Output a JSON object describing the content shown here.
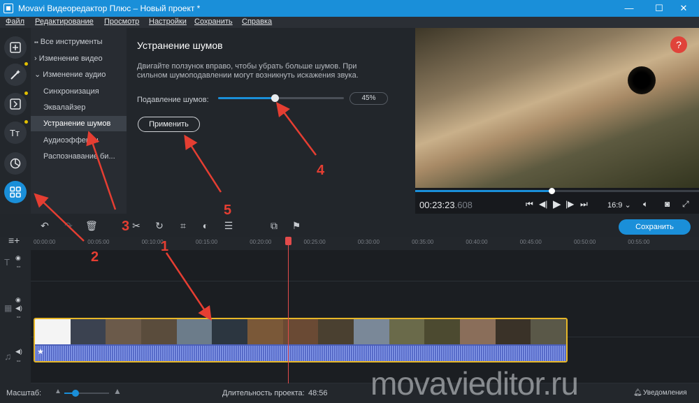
{
  "window": {
    "title": "Movavi Видеоредактор Плюс – Новый проект *",
    "minimize": "—",
    "maximize": "☐",
    "close": "✕"
  },
  "menu": [
    "Файл",
    "Редактирование",
    "Просмотр",
    "Настройки",
    "Сохранить",
    "Справка"
  ],
  "tools": {
    "items": [
      {
        "label": "Все инструменты",
        "prefix": "▪▪"
      },
      {
        "label": "Изменение видео",
        "prefix": "›"
      },
      {
        "label": "Изменение аудио",
        "prefix": "⌄"
      },
      {
        "label": "Синхронизация",
        "prefix": ""
      },
      {
        "label": "Эквалайзер",
        "prefix": ""
      },
      {
        "label": "Устранение шумов",
        "prefix": ""
      },
      {
        "label": "Аудиоэффекты",
        "prefix": ""
      },
      {
        "label": "Распознавание би...",
        "prefix": ""
      }
    ]
  },
  "panel": {
    "title": "Устранение шумов",
    "description": "Двигайте ползунок вправо, чтобы убрать больше шумов. При сильном шумоподавлении могут возникнуть искажения звука.",
    "slider_label": "Подавление шумов:",
    "slider_value": "45%",
    "slider_fraction": 0.45,
    "apply": "Применить"
  },
  "preview": {
    "help": "?",
    "progress_fraction": 0.48,
    "timecode": "00:23:23",
    "timecode_ms": ".608",
    "aspect": "16:9 ⌄"
  },
  "toolbar": {
    "save": "Сохранить"
  },
  "ruler": [
    "00:00:00",
    "00:05:00",
    "00:10:00",
    "00:15:00",
    "00:20:00",
    "00:25:00",
    "00:30:00",
    "00:35:00",
    "00:40:00",
    "00:45:00",
    "00:50:00",
    "00:55:00"
  ],
  "thumb_colors": [
    "#f4f4f4",
    "#3b4250",
    "#6b5a4a",
    "#5a4c3c",
    "#6c7c8a",
    "#2c3640",
    "#7a5838",
    "#6a4a34",
    "#4a4030",
    "#7a8898",
    "#6a6a4a",
    "#4c4a30",
    "#8a6e5a",
    "#3a3228",
    "#5a5848"
  ],
  "status": {
    "scale_label": "Масштаб:",
    "duration_label": "Длительность проекта:",
    "duration": "48:56",
    "notifications": "Уведомления"
  },
  "watermark": "movavieditor.ru",
  "annotations": [
    "1",
    "2",
    "3",
    "4",
    "5"
  ],
  "colors": {
    "accent": "#1a8fd9",
    "clip_border": "#e7b728",
    "playhead": "#e24b4b",
    "annotation": "#e53e32"
  }
}
